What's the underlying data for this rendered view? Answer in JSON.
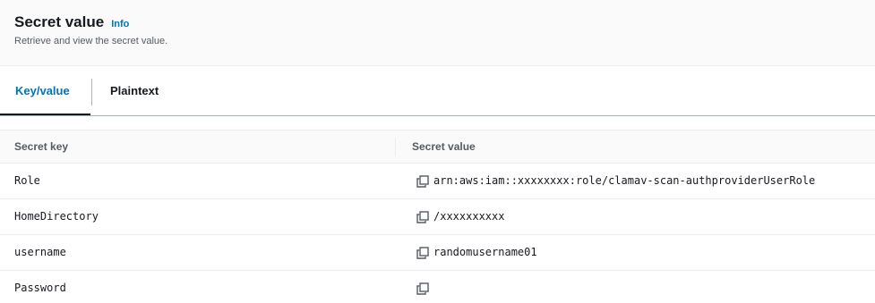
{
  "header": {
    "title": "Secret value",
    "info_link": "Info",
    "subtitle": "Retrieve and view the secret value."
  },
  "tabs": [
    {
      "label": "Key/value",
      "active": true
    },
    {
      "label": "Plaintext",
      "active": false
    }
  ],
  "table": {
    "columns": [
      "Secret key",
      "Secret value"
    ],
    "rows": [
      {
        "key": "Role",
        "value": "arn:aws:iam::xxxxxxxx:role/clamav-scan-authproviderUserRole",
        "icon": "copy-icon"
      },
      {
        "key": "HomeDirectory",
        "value": "/xxxxxxxxxx",
        "icon": "copy-icon"
      },
      {
        "key": "username",
        "value": "randomusername01",
        "icon": "copy-icon"
      },
      {
        "key": "Password",
        "value": "",
        "icon": "copy-icon"
      }
    ]
  },
  "colors": {
    "accent": "#0073bb",
    "text": "#16191f",
    "muted": "#545b64",
    "border": "#eaeded"
  }
}
